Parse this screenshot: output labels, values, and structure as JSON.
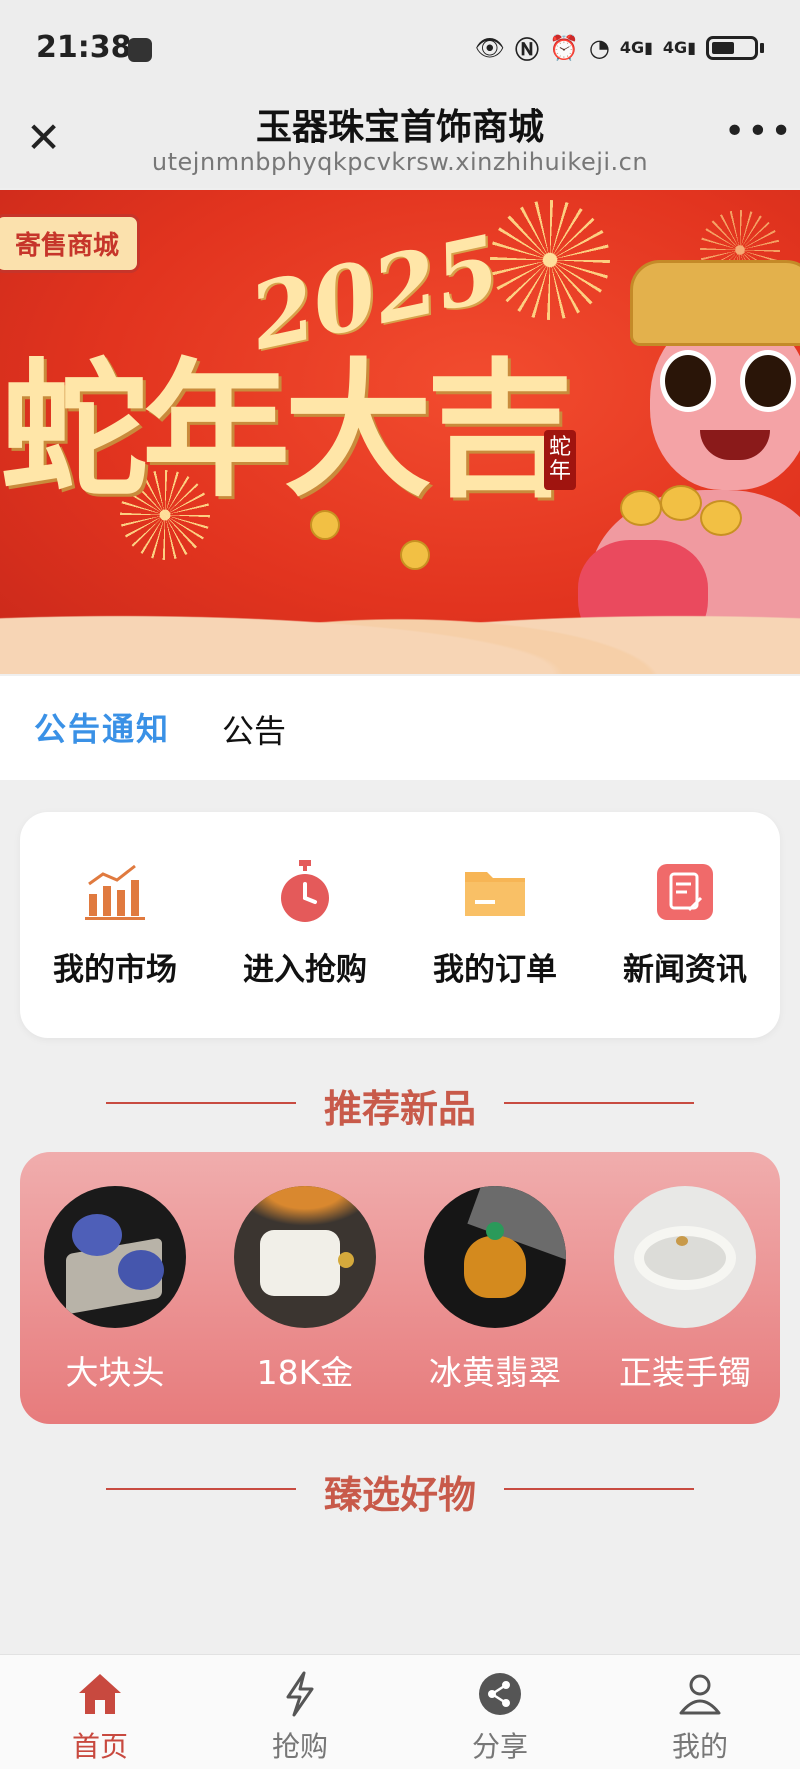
{
  "status_bar": {
    "time": "21:38",
    "network_1": "4G",
    "network_2": "4G"
  },
  "nav": {
    "title": "玉器珠宝首饰商城",
    "url": "utejnmnbphyqkpcvkrsw.xinzhihuikeji.cn",
    "close_icon": "close-icon",
    "more_icon": "more-icon"
  },
  "banner": {
    "tag": "寄售商城",
    "year": "2025",
    "headline": "蛇年大吉",
    "seal": "蛇年"
  },
  "notice": {
    "label": "公告通知",
    "text": "公告"
  },
  "quick_links": [
    {
      "label": "我的市场",
      "icon": "bar-chart-icon",
      "color": "#e07a3f"
    },
    {
      "label": "进入抢购",
      "icon": "stopwatch-icon",
      "color": "#e45a5a"
    },
    {
      "label": "我的订单",
      "icon": "folder-icon",
      "color": "#f7b555"
    },
    {
      "label": "新闻资讯",
      "icon": "clipboard-icon",
      "color": "#f06a6a"
    }
  ],
  "sections": {
    "recommended": "推荐新品",
    "featured": "臻选好物"
  },
  "products": [
    {
      "name": "大块头"
    },
    {
      "name": "18K金"
    },
    {
      "name": "冰黄翡翠"
    },
    {
      "name": "正装手镯"
    }
  ],
  "tabbar": [
    {
      "label": "首页",
      "icon": "home-icon",
      "active": true
    },
    {
      "label": "抢购",
      "icon": "lightning-icon",
      "active": false
    },
    {
      "label": "分享",
      "icon": "share-icon",
      "active": false
    },
    {
      "label": "我的",
      "icon": "user-icon",
      "active": false
    }
  ],
  "colors": {
    "accent": "#c8493f",
    "notice_blue": "#3a91e6",
    "banner_red": "#e2341f",
    "product_card": "#e77b7c"
  }
}
